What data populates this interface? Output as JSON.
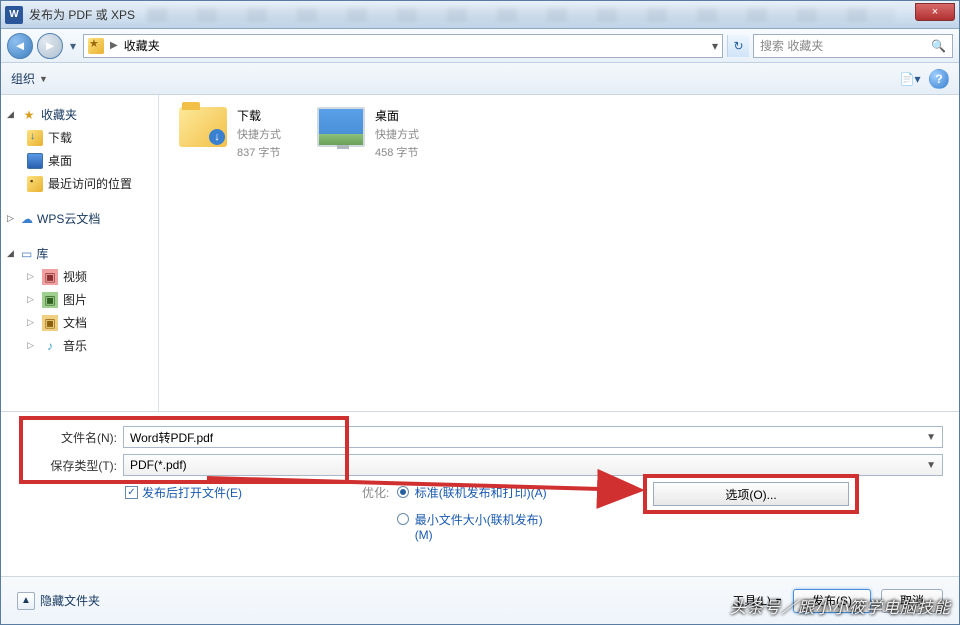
{
  "titlebar": {
    "title": "发布为 PDF 或 XPS",
    "close": "×",
    "app_icon_text": "W"
  },
  "navbar": {
    "breadcrumb": "收藏夹",
    "search_placeholder": "搜索 收藏夹"
  },
  "toolbar": {
    "organize": "组织"
  },
  "sidebar": {
    "favorites": {
      "label": "收藏夹",
      "items": [
        "下载",
        "桌面",
        "最近访问的位置"
      ]
    },
    "wps": {
      "label": "WPS云文档"
    },
    "libraries": {
      "label": "库",
      "items": [
        "视频",
        "图片",
        "文档",
        "音乐"
      ]
    }
  },
  "content": {
    "item1": {
      "name": "下载",
      "type": "快捷方式",
      "size": "837 字节"
    },
    "item2": {
      "name": "桌面",
      "type": "快捷方式",
      "size": "458 字节"
    }
  },
  "form": {
    "filename_label": "文件名(N):",
    "filename_value": "Word转PDF.pdf",
    "type_label": "保存类型(T):",
    "type_value": "PDF(*.pdf)",
    "open_after": "发布后打开文件(E)",
    "optimize_label": "优化:",
    "opt_standard": "标准(联机发布和打印)(A)",
    "opt_min": "最小文件大小(联机发布)(M)",
    "options_btn": "选项(O)..."
  },
  "footer": {
    "hide_folders": "隐藏文件夹",
    "tools": "工具(L)",
    "publish": "发布(S)",
    "cancel": "取消"
  },
  "watermark": "头条号／跟小小筱学电脑技能"
}
